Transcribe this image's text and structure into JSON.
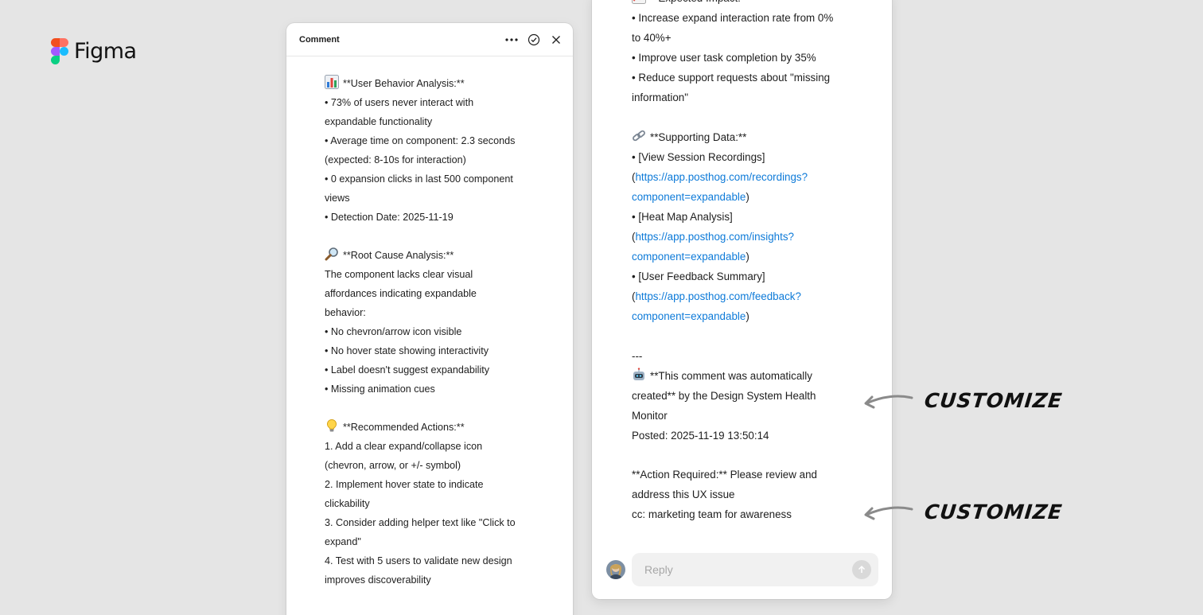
{
  "app": {
    "name": "Figma"
  },
  "left_panel": {
    "title": "Comment",
    "lines": [
      {
        "emoji": "chart-icon",
        "text": "**User Behavior Analysis:**"
      },
      {
        "text": "• 73% of users never interact with"
      },
      {
        "text": "expandable functionality"
      },
      {
        "text": "• Average time on component: 2.3 seconds"
      },
      {
        "text": "(expected: 8-10s for interaction)"
      },
      {
        "text": "• 0 expansion clicks in last 500 component"
      },
      {
        "text": "views"
      },
      {
        "text": "• Detection Date: 2025-11-19"
      },
      {
        "text": ""
      },
      {
        "emoji": "magnifier-icon",
        "text": "**Root Cause Analysis:**"
      },
      {
        "text": "The component lacks clear visual"
      },
      {
        "text": "affordances indicating expandable"
      },
      {
        "text": "behavior:"
      },
      {
        "text": "• No chevron/arrow icon visible"
      },
      {
        "text": "• No hover state showing interactivity"
      },
      {
        "text": "• Label doesn't suggest expandability"
      },
      {
        "text": "• Missing animation cues"
      },
      {
        "text": ""
      },
      {
        "emoji": "lightbulb-icon",
        "text": "**Recommended Actions:**"
      },
      {
        "text": "1. Add a clear expand/collapse icon"
      },
      {
        "text": "(chevron, arrow, or +/- symbol)"
      },
      {
        "text": "2. Implement hover state to indicate"
      },
      {
        "text": "clickability"
      },
      {
        "text": "3. Consider adding helper text like \"Click to"
      },
      {
        "text": "expand\""
      },
      {
        "text": "4. Test with 5 users to validate new design"
      },
      {
        "text": "improves discoverability"
      }
    ]
  },
  "right_panel": {
    "lines": [
      {
        "emoji": "trend-icon",
        "text": "**Expected Impact:**"
      },
      {
        "text": "• Increase expand interaction rate from 0%"
      },
      {
        "text": "to 40%+"
      },
      {
        "text": "• Improve user task completion by 35%"
      },
      {
        "text": "• Reduce support requests about \"missing"
      },
      {
        "text": "information\""
      },
      {
        "text": ""
      },
      {
        "emoji": "link-icon",
        "text": "**Supporting Data:**"
      },
      {
        "text": "• [View Session Recordings]"
      },
      {
        "pre": "(",
        "link": "https://app.posthog.com/recordings?",
        "post": ""
      },
      {
        "pre": "",
        "link": "component=expandable",
        "post": ")"
      },
      {
        "text": "• [Heat Map Analysis]"
      },
      {
        "pre": "(",
        "link": "https://app.posthog.com/insights?",
        "post": ""
      },
      {
        "pre": "",
        "link": "component=expandable",
        "post": ")"
      },
      {
        "text": "• [User Feedback Summary]"
      },
      {
        "pre": "(",
        "link": "https://app.posthog.com/feedback?",
        "post": ""
      },
      {
        "pre": "",
        "link": "component=expandable",
        "post": ")"
      },
      {
        "text": ""
      },
      {
        "text": "---"
      },
      {
        "emoji": "robot-icon",
        "text": "**This comment was automatically"
      },
      {
        "text": "created** by the Design System Health"
      },
      {
        "text": "Monitor"
      },
      {
        "text": "Posted: 2025-11-19 13:50:14"
      },
      {
        "text": ""
      },
      {
        "text": "**Action Required:** Please review and"
      },
      {
        "text": "address this UX issue"
      },
      {
        "text": "cc: marketing team for awareness"
      }
    ],
    "reply_placeholder": "Reply"
  },
  "annotations": [
    {
      "label": "CUSTOMIZE"
    },
    {
      "label": "CUSTOMIZE"
    }
  ],
  "colors": {
    "background": "#e5e5e5",
    "link": "#0d7ad8",
    "panel": "#ffffff"
  }
}
